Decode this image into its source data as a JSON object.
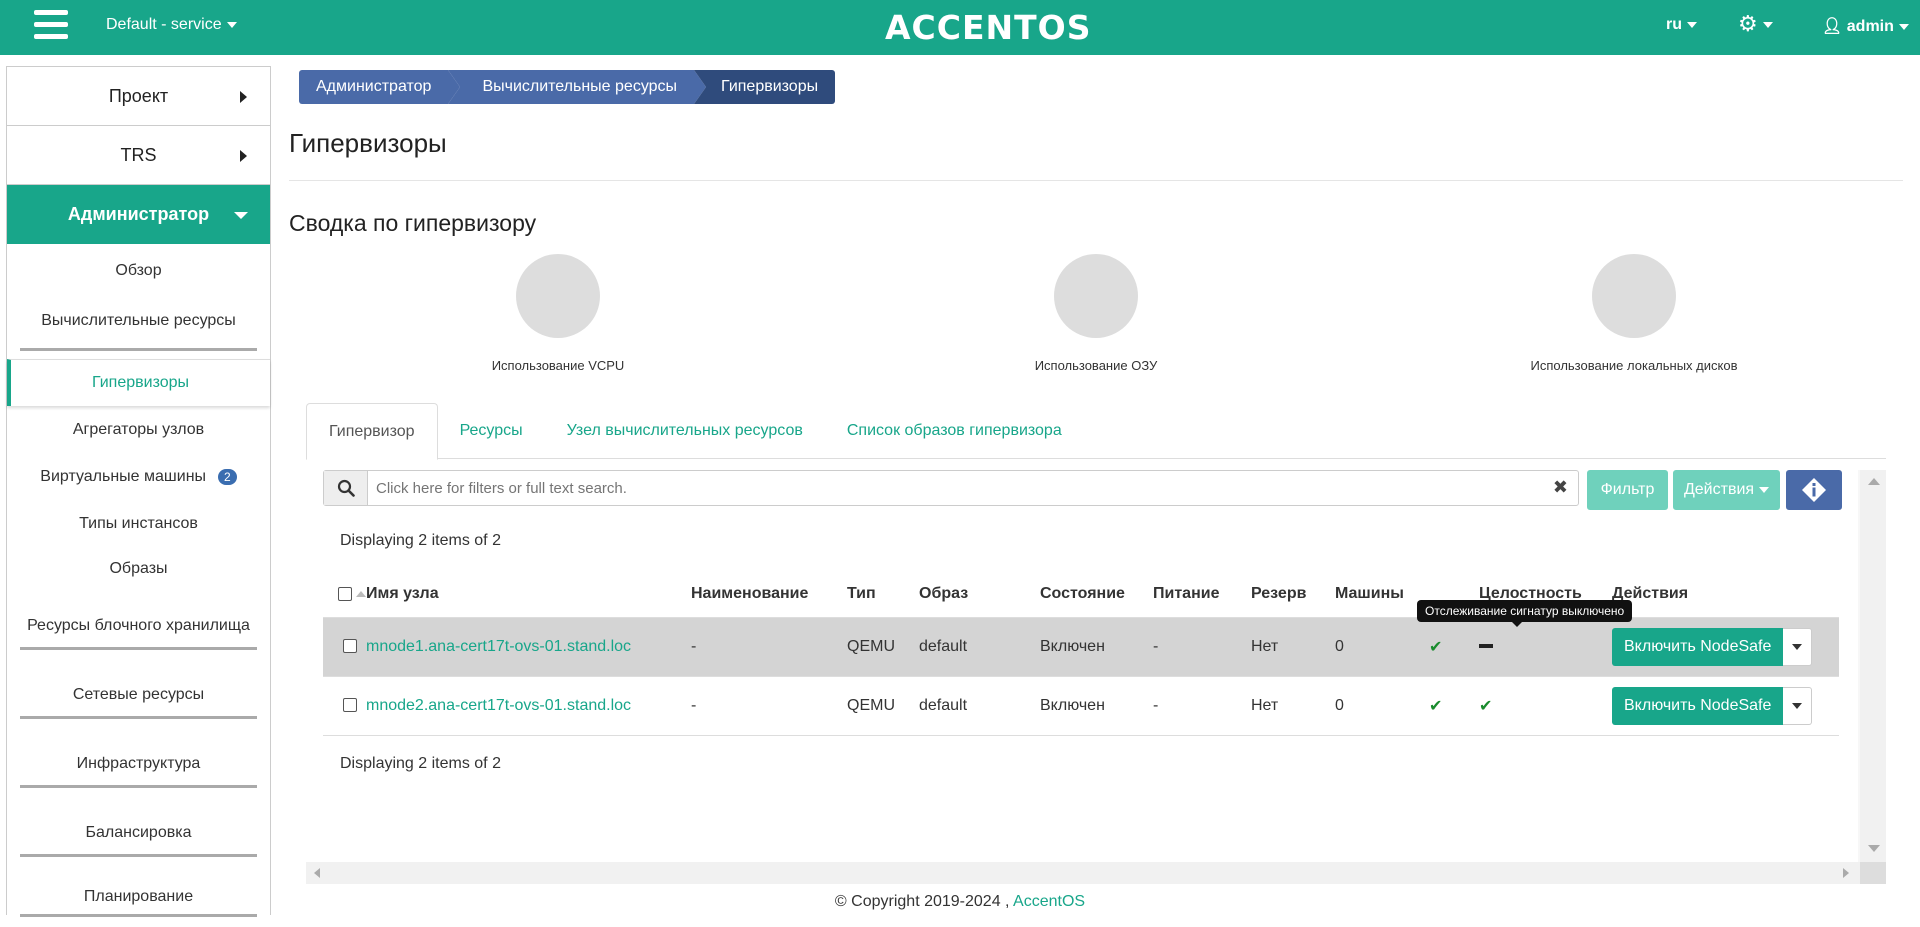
{
  "topbar": {
    "project": "Default - service",
    "logo": "ACCENTOS",
    "lang": "ru",
    "user": "admin"
  },
  "sidebar": {
    "sections": [
      {
        "label": "Проект"
      },
      {
        "label": "TRS"
      },
      {
        "label": "Администратор"
      }
    ],
    "items": [
      {
        "label": "Обзор"
      },
      {
        "label": "Вычислительные ресурсы"
      },
      {
        "label": "Гипервизоры"
      },
      {
        "label": "Агрегаторы узлов"
      },
      {
        "label": "Виртуальные машины",
        "badge": "2"
      },
      {
        "label": "Типы инстансов"
      },
      {
        "label": "Образы"
      }
    ],
    "groups": [
      {
        "label": "Ресурсы блочного хранилища"
      },
      {
        "label": "Сетевые ресурсы"
      },
      {
        "label": "Инфраструктура"
      },
      {
        "label": "Балансировка"
      },
      {
        "label": "Планирование"
      }
    ]
  },
  "breadcrumb": [
    "Администратор",
    "Вычислительные ресурсы",
    "Гипервизоры"
  ],
  "page_title": "Гипервизоры",
  "summary": {
    "title": "Сводка по гипервизору",
    "charts": [
      {
        "label": "Использование VCPU"
      },
      {
        "label": "Использование ОЗУ"
      },
      {
        "label": "Использование локальных дисков"
      }
    ]
  },
  "tabs": [
    "Гипервизор",
    "Ресурсы",
    "Узел вычислительных ресурсов",
    "Список образов гипервизора"
  ],
  "toolbar": {
    "search_placeholder": "Click here for filters or full text search.",
    "filter": "Фильтр",
    "actions": "Действия"
  },
  "display_count": "Displaying 2 items of 2",
  "table": {
    "headers": [
      "Имя узла",
      "Наименование",
      "Тип",
      "Образ",
      "Состояние",
      "Питание",
      "Резерв",
      "Машины",
      "Целостность",
      "Действия"
    ],
    "rows": [
      {
        "host": "mnode1.ana-cert17t-ovs-01.stand.loc",
        "name": "-",
        "type": "QEMU",
        "image": "default",
        "state": "Включен",
        "power": "-",
        "reserve": "Нет",
        "machines": "0",
        "action": "Включить NodeSafe"
      },
      {
        "host": "mnode2.ana-cert17t-ovs-01.stand.loc",
        "name": "-",
        "type": "QEMU",
        "image": "default",
        "state": "Включен",
        "power": "-",
        "reserve": "Нет",
        "machines": "0",
        "action": "Включить NodeSafe"
      }
    ]
  },
  "tooltip": "Отслеживание сигнатур выключено",
  "footer": {
    "text": "© Copyright 2019-2024 ,",
    "link": "AccentOS"
  },
  "colors": {
    "brand": "#18a68a",
    "breadcrumb": "#4a6aa8",
    "breadcrumb_active": "#2f4b7c"
  }
}
